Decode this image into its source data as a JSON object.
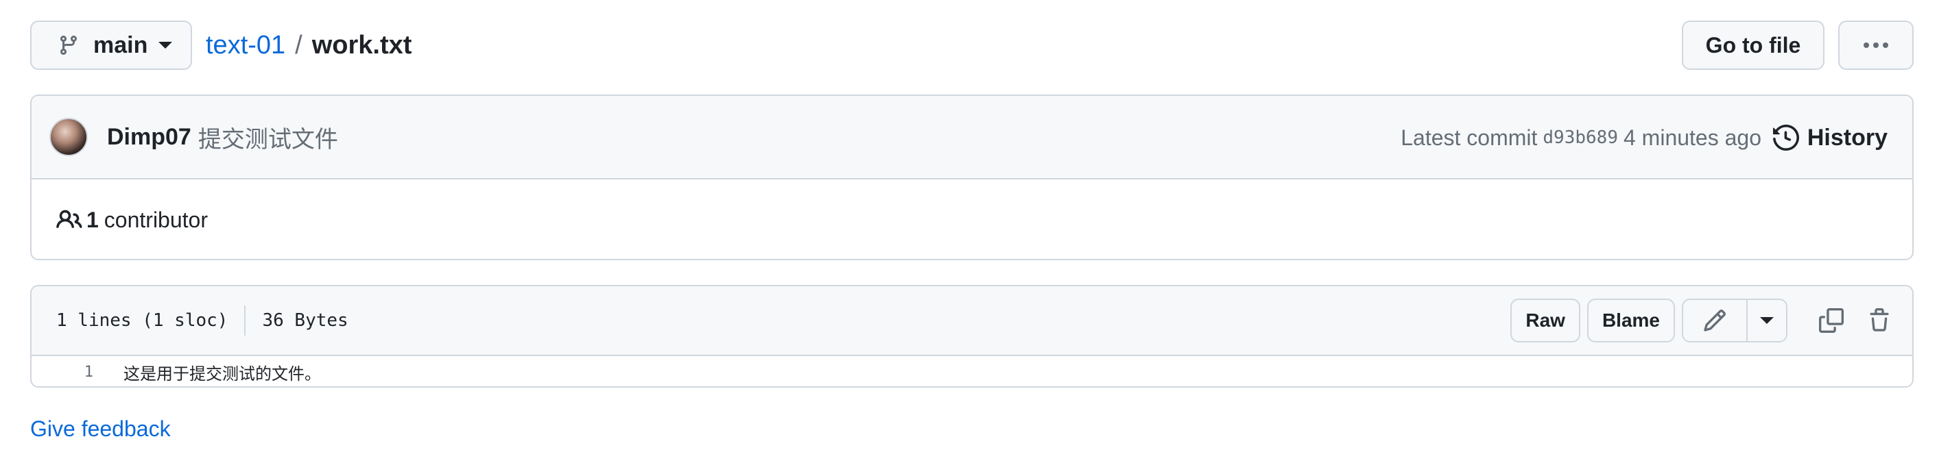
{
  "header": {
    "branch": "main",
    "repo": "text-01",
    "separator": "/",
    "file": "work.txt",
    "go_to_file": "Go to file"
  },
  "commit": {
    "author": "Dimp07",
    "message": "提交测试文件",
    "latest_label": "Latest commit",
    "sha": "d93b689",
    "time": "4 minutes ago",
    "history_label": "History"
  },
  "contributors": {
    "count": "1",
    "label": "contributor"
  },
  "file": {
    "lines_info": "1 lines (1 sloc)",
    "size": "36 Bytes",
    "raw_label": "Raw",
    "blame_label": "Blame",
    "lines": [
      {
        "number": "1",
        "text": "这是用于提交测试的文件。"
      }
    ]
  },
  "footer": {
    "feedback": "Give feedback"
  },
  "colors": {
    "link": "#0969da",
    "border": "#d0d7de",
    "muted": "#656d76",
    "surface": "#f6f8fa"
  },
  "icons": [
    "git-branch-icon",
    "caret-down-icon",
    "kebab-horizontal-icon",
    "avatar",
    "history-icon",
    "people-icon",
    "pencil-icon",
    "copy-icon",
    "trash-icon"
  ]
}
